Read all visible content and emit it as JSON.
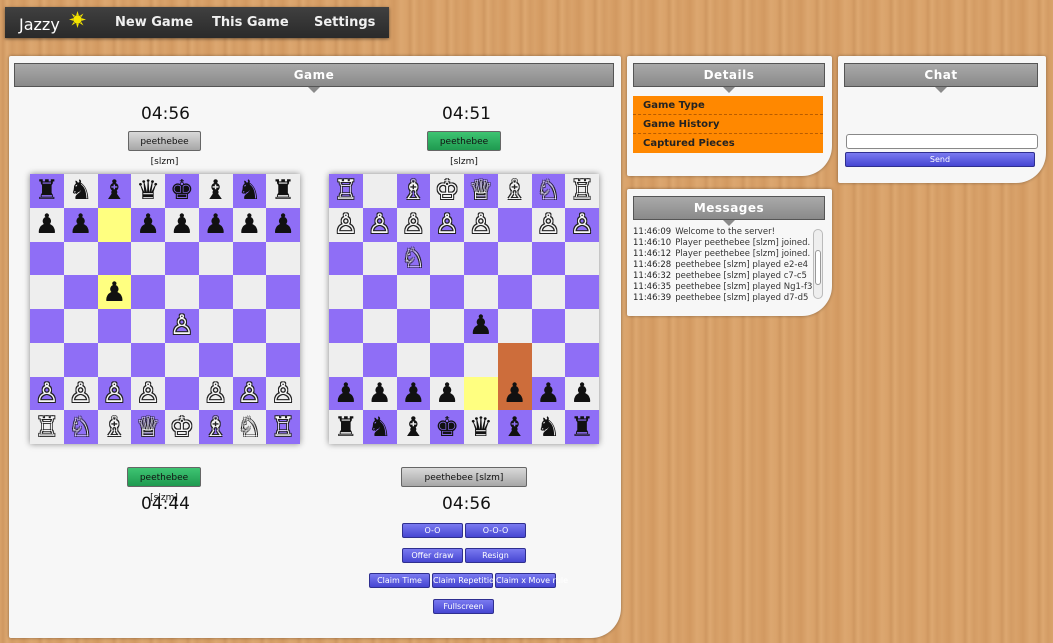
{
  "nav": {
    "logo": "Jazzy",
    "items": [
      "New Game",
      "This Game",
      "Settings"
    ]
  },
  "game": {
    "title": "Game",
    "left": {
      "top_clock": "04:56",
      "top_player": "peethebee [slzm]",
      "bottom_clock": "04:44",
      "bottom_player": "peethebee [slzm]",
      "board": [
        [
          "♜",
          "♞",
          "♝",
          "♛",
          "♚",
          "♝",
          "♞",
          "♜"
        ],
        [
          "♟",
          "♟",
          "",
          "♟",
          "♟",
          "♟",
          "♟",
          "♟"
        ],
        [
          "",
          "",
          "",
          "",
          "",
          "",
          "",
          ""
        ],
        [
          "",
          "",
          "♟",
          "",
          "",
          "",
          "",
          ""
        ],
        [
          "",
          "",
          "",
          "",
          "♙",
          "",
          "",
          ""
        ],
        [
          "",
          "",
          "",
          "",
          "",
          "",
          "",
          ""
        ],
        [
          "♙",
          "♙",
          "♙",
          "♙",
          "",
          "♙",
          "♙",
          "♙"
        ],
        [
          "♖",
          "♘",
          "♗",
          "♕",
          "♔",
          "♗",
          "♘",
          "♖"
        ]
      ],
      "highlights": [
        [
          1,
          2
        ],
        [
          3,
          2
        ]
      ]
    },
    "right": {
      "top_clock": "04:51",
      "top_player": "peethebee [slzm]",
      "bottom_clock": "04:56",
      "bottom_player": "peethebee [slzm]",
      "board": [
        [
          "♖",
          "",
          "♗",
          "♔",
          "♕",
          "♗",
          "♘",
          "♖"
        ],
        [
          "♙",
          "♙",
          "♙",
          "♙",
          "♙",
          "",
          "♙",
          "♙"
        ],
        [
          "",
          "",
          "♘",
          "",
          "",
          "",
          "",
          ""
        ],
        [
          "",
          "",
          "",
          "",
          "",
          "",
          "",
          ""
        ],
        [
          "",
          "",
          "",
          "",
          "♟",
          "",
          "",
          ""
        ],
        [
          "",
          "",
          "",
          "",
          "",
          "",
          "",
          ""
        ],
        [
          "♟",
          "♟",
          "♟",
          "♟",
          "",
          "♟",
          "♟",
          "♟"
        ],
        [
          "♜",
          "♞",
          "♝",
          "♚",
          "♛",
          "♝",
          "♞",
          "♜"
        ]
      ],
      "highlights": [
        [
          6,
          4
        ]
      ],
      "highlights_dark": [
        [
          5,
          5
        ],
        [
          6,
          5
        ]
      ]
    },
    "buttons": {
      "short_castle": "O-O",
      "long_castle": "O-O-O",
      "offer_draw": "Offer draw",
      "resign": "Resign",
      "claim_time": "Claim Time",
      "claim_repetition": "Claim Repetition",
      "claim_x_move": "Claim x Move rule",
      "fullscreen": "Fullscreen"
    }
  },
  "details": {
    "title": "Details",
    "tabs": [
      "Game Type",
      "Game History",
      "Captured Pieces"
    ]
  },
  "messages": {
    "title": "Messages",
    "items": [
      {
        "time": "11:46:09",
        "text": "Welcome to the server!"
      },
      {
        "time": "11:46:10",
        "text": "Player peethebee [slzm] joined."
      },
      {
        "time": "11:46:12",
        "text": "Player peethebee [slzm] joined."
      },
      {
        "time": "11:46:28",
        "text": "peethebee [slzm] played e2-e4"
      },
      {
        "time": "11:46:32",
        "text": "peethebee [slzm] played c7-c5"
      },
      {
        "time": "11:46:35",
        "text": "peethebee [slzm] played Ng1-f3"
      },
      {
        "time": "11:46:39",
        "text": "peethebee [slzm] played d7-d5"
      }
    ]
  },
  "chat": {
    "title": "Chat",
    "input_value": "",
    "send_label": "Send"
  }
}
